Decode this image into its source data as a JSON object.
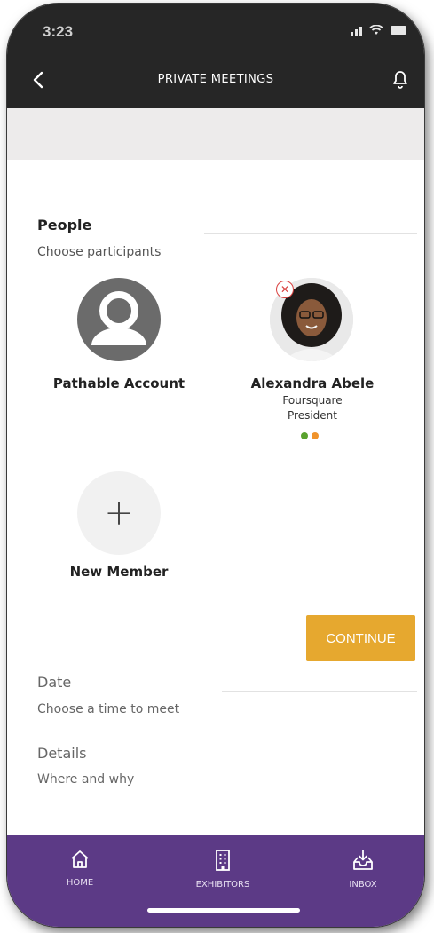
{
  "status": {
    "time": "3:23"
  },
  "header": {
    "title": "PRIVATE MEETINGS"
  },
  "people": {
    "title": "People",
    "subtitle": "Choose participants",
    "participants": [
      {
        "name": "Pathable Account"
      },
      {
        "name": "Alexandra Abele",
        "company": "Foursquare",
        "role": "President"
      }
    ],
    "add_label": "New Member"
  },
  "continue_label": "CONTINUE",
  "date": {
    "title": "Date",
    "subtitle": "Choose a time to meet"
  },
  "details": {
    "title": "Details",
    "subtitle": "Where and why"
  },
  "nav": {
    "items": [
      {
        "label": "HOME",
        "icon": "home-icon"
      },
      {
        "label": "EXHIBITORS",
        "icon": "building-icon"
      },
      {
        "label": "INBOX",
        "icon": "inbox-download-icon"
      }
    ]
  },
  "colors": {
    "header_bg": "#262626",
    "accent": "#e6a82f",
    "nav_bg": "#5c3a86",
    "status_dot_green": "#5aa22e",
    "status_dot_orange": "#f0932b"
  }
}
